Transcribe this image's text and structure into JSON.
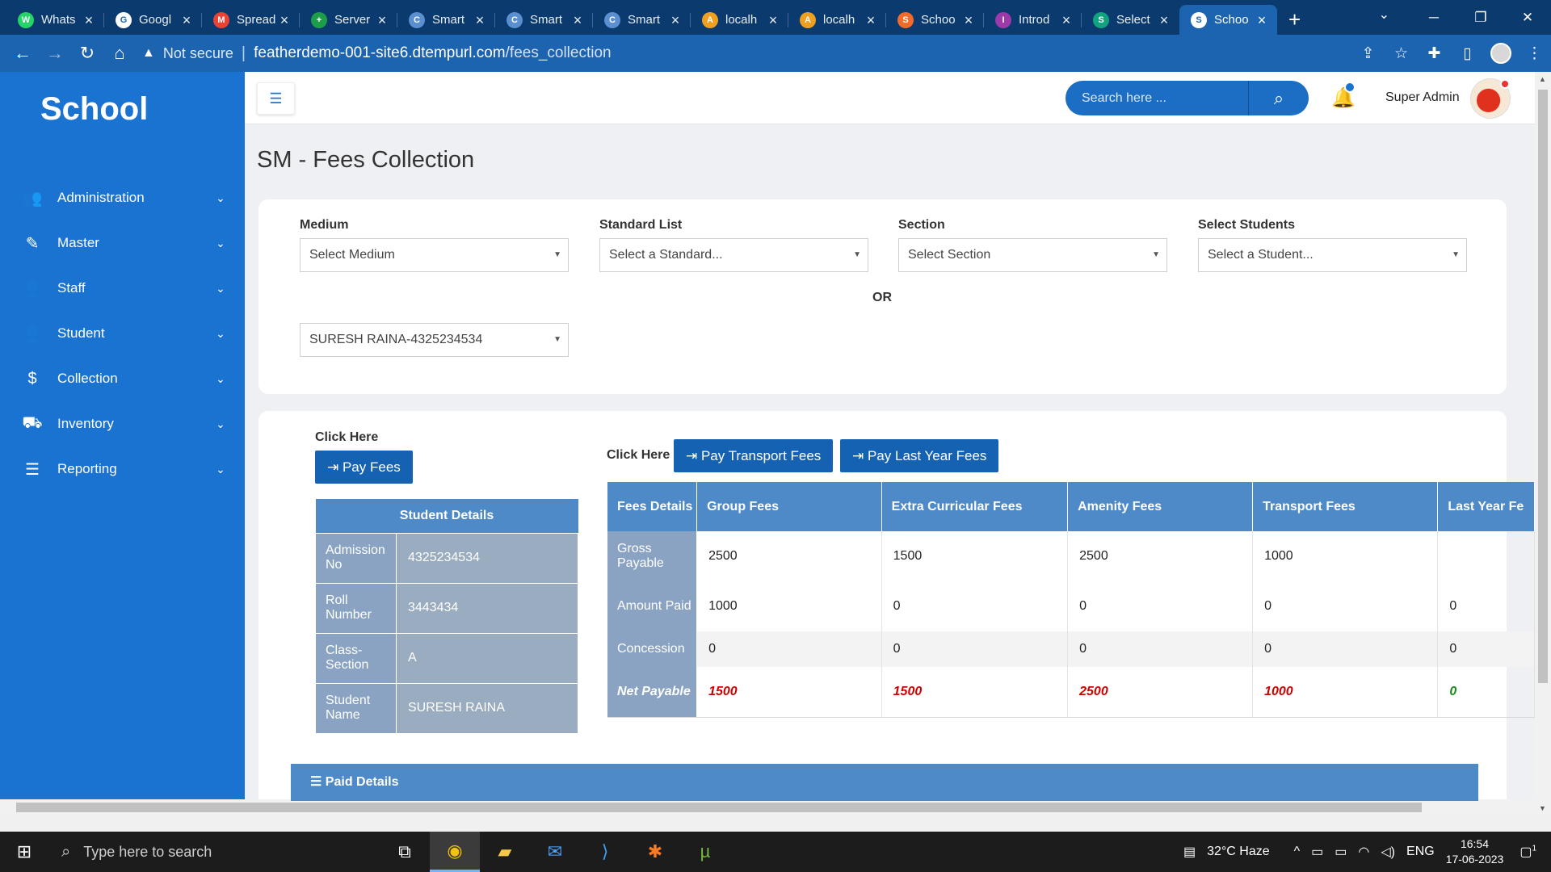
{
  "browser": {
    "tabs": [
      {
        "title": "Whats",
        "fav_color": "#25d366",
        "fav_char": "W"
      },
      {
        "title": "Googl",
        "fav_color": "#ffffff",
        "fav_char": "G"
      },
      {
        "title": "Spread",
        "fav_color": "#ea4335",
        "fav_char": "M"
      },
      {
        "title": "Server",
        "fav_color": "#1e9e4a",
        "fav_char": "+"
      },
      {
        "title": "Smart",
        "fav_color": "#5a8fd0",
        "fav_char": "C"
      },
      {
        "title": "Smart",
        "fav_color": "#5a8fd0",
        "fav_char": "C"
      },
      {
        "title": "Smart",
        "fav_color": "#5a8fd0",
        "fav_char": "C"
      },
      {
        "title": "localh",
        "fav_color": "#f0a020",
        "fav_char": "A"
      },
      {
        "title": "localh",
        "fav_color": "#f0a020",
        "fav_char": "A"
      },
      {
        "title": "Schoo",
        "fav_color": "#f26b2a",
        "fav_char": "S"
      },
      {
        "title": "Introd",
        "fav_color": "#9b3aa8",
        "fav_char": "I"
      },
      {
        "title": "Select",
        "fav_color": "#10a37f",
        "fav_char": "S"
      },
      {
        "title": "Schoo",
        "fav_color": "#ffffff",
        "fav_char": "S"
      }
    ],
    "active_tab_index": 12,
    "security_label": "Not secure",
    "url_host": "featherdemo-001-site6.dtempurl.com",
    "url_path": "/fees_collection"
  },
  "sidebar": {
    "brand": "School",
    "items": [
      {
        "label": "Administration",
        "icon": "users-icon",
        "glyph": "👥"
      },
      {
        "label": "Master",
        "icon": "edit-icon",
        "glyph": "✎"
      },
      {
        "label": "Staff",
        "icon": "person-icon",
        "glyph": "👤"
      },
      {
        "label": "Student",
        "icon": "person-icon",
        "glyph": "👤"
      },
      {
        "label": "Collection",
        "icon": "dollar-icon",
        "glyph": "$"
      },
      {
        "label": "Inventory",
        "icon": "truck-icon",
        "glyph": "⛟"
      },
      {
        "label": "Reporting",
        "icon": "list-icon",
        "glyph": "☰"
      }
    ]
  },
  "header": {
    "search_placeholder": "Search here ...",
    "user_name": "Super Admin"
  },
  "page_title": "SM - Fees Collection",
  "filters": {
    "medium": {
      "label": "Medium",
      "value": "Select Medium"
    },
    "standard": {
      "label": "Standard List",
      "value": "Select a Standard..."
    },
    "section": {
      "label": "Section",
      "value": "Select Section"
    },
    "student": {
      "label": "Select Students",
      "value": "Select a Student..."
    },
    "or_label": "OR",
    "student_direct": {
      "value": "SURESH RAINA-4325234534"
    }
  },
  "actions": {
    "click_here": "Click Here",
    "pay_fees": "Pay Fees",
    "pay_transport": "Pay Transport Fees",
    "pay_last_year": "Pay Last Year Fees"
  },
  "student_details": {
    "title": "Student Details",
    "rows": [
      {
        "key": "Admission No",
        "value": "4325234534"
      },
      {
        "key": "Roll Number",
        "value": "3443434"
      },
      {
        "key": "Class-Section",
        "value": "A"
      },
      {
        "key": "Student Name",
        "value": "SURESH RAINA"
      }
    ]
  },
  "fees": {
    "header": "Fees Details",
    "columns": [
      "Group Fees",
      "Extra Curricular Fees",
      "Amenity Fees",
      "Transport Fees",
      "Last Year Fe"
    ],
    "rows": [
      {
        "label": "Gross Payable",
        "values": [
          "2500",
          "1500",
          "2500",
          "1000",
          ""
        ]
      },
      {
        "label": "Amount Paid",
        "values": [
          "1000",
          "0",
          "0",
          "0",
          "0"
        ]
      },
      {
        "label": "Concession",
        "values": [
          "0",
          "0",
          "0",
          "0",
          "0"
        ]
      },
      {
        "label": "Net Payable",
        "values": [
          "1500",
          "1500",
          "2500",
          "1000",
          "0"
        ]
      }
    ]
  },
  "paid_details": {
    "title": "Paid Details"
  },
  "taskbar": {
    "search_placeholder": "Type here to search",
    "weather": "32°C Haze",
    "lang": "ENG",
    "time": "16:54",
    "date": "17-06-2023",
    "notif_count": "1"
  }
}
